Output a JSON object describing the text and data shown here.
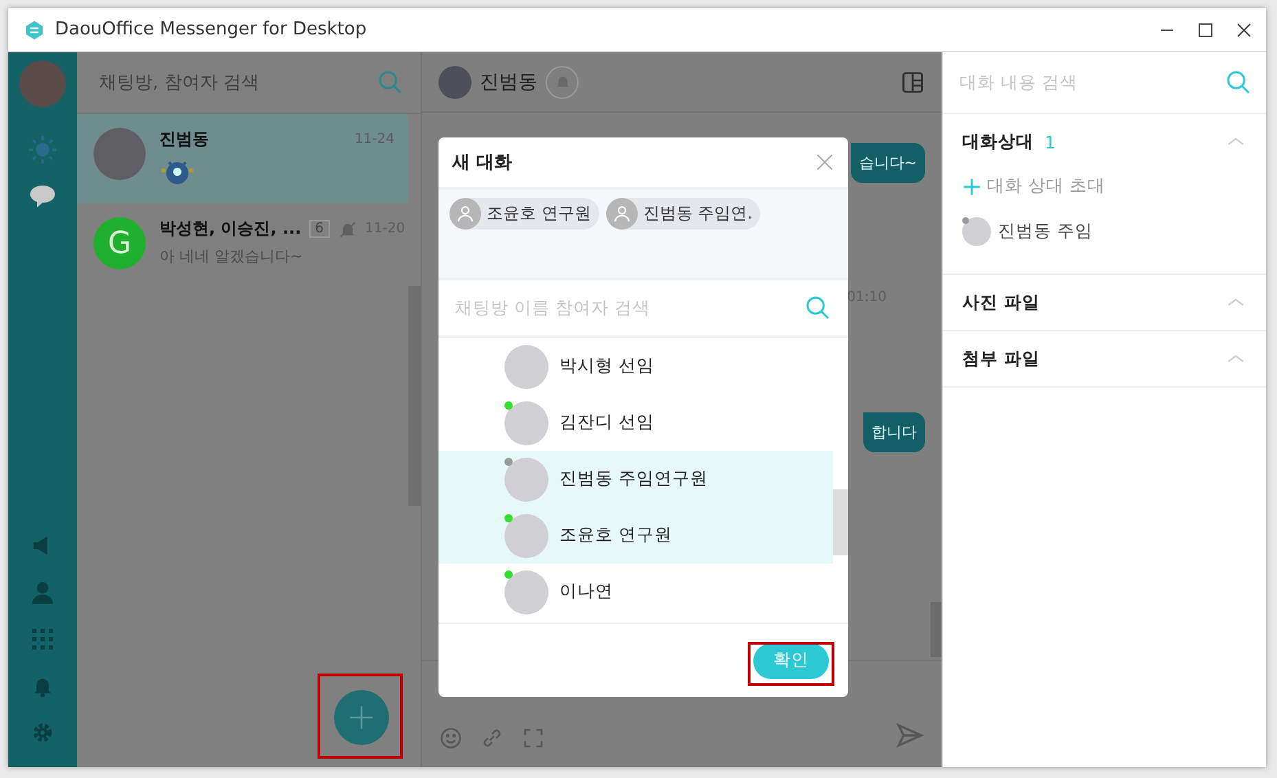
{
  "window": {
    "title": "DaouOffice Messenger for Desktop"
  },
  "rail": {
    "items": [
      {
        "kind": "timeline",
        "selected": false
      },
      {
        "kind": "chat",
        "selected": true
      },
      {
        "kind": "notice",
        "selected": false
      },
      {
        "kind": "contacts",
        "selected": false
      },
      {
        "kind": "apps",
        "selected": false
      },
      {
        "kind": "alerts",
        "selected": false
      },
      {
        "kind": "settings",
        "selected": false
      }
    ]
  },
  "chat_list": {
    "search": {
      "placeholder": "채팅방, 참여자 검색"
    },
    "rooms": [
      {
        "kind": "sticker",
        "name": "진범동",
        "time": "11-24",
        "selected": true
      },
      {
        "kind": "text",
        "name": "박성현, 이승진, ...",
        "time": "11-20",
        "selected": false,
        "initial": "G",
        "color": "#1fb02d",
        "unread": "6",
        "muted": true,
        "preview": "아 네네 알겠습니다~"
      }
    ],
    "new_chat_button": {
      "highlighted": true
    }
  },
  "chat": {
    "header": {
      "name": "진범동"
    },
    "messages": [
      {
        "kind": "bubble",
        "text": "습니다~"
      },
      {
        "kind": "time",
        "text": "01:10"
      },
      {
        "kind": "bubble",
        "text": "합니다"
      }
    ]
  },
  "dialog": {
    "title": "새 대화",
    "chips": [
      {
        "label": "조윤호 연구원"
      },
      {
        "label": "진범동 주임연."
      }
    ],
    "search": {
      "placeholder": "채팅방 이름 참여자 검색"
    },
    "contacts": [
      {
        "name": "박시형 선임",
        "selected": false
      },
      {
        "name": "김잔디 선임",
        "selected": false,
        "color": "#33e02e"
      },
      {
        "name": "진범동 주임연구원",
        "selected": true,
        "color": "#9a9a9a"
      },
      {
        "name": "조윤호 연구원",
        "selected": true,
        "color": "#33e02e"
      },
      {
        "name": "이나연",
        "selected": false,
        "color": "#33e02e"
      }
    ],
    "confirm": {
      "label": "확인",
      "highlighted": true
    }
  },
  "right_panel": {
    "search": {
      "placeholder": "대화 내용 검색"
    },
    "sections": [
      {
        "title": "대화상대",
        "count": "1",
        "expanded": true,
        "invite": "대화 상대 초대",
        "members": [
          {
            "name": "진범동 주임",
            "color": "#9a9a9a"
          }
        ]
      },
      {
        "title": "사진 파일",
        "expanded": true
      },
      {
        "title": "첨부 파일",
        "expanded": true
      }
    ]
  }
}
